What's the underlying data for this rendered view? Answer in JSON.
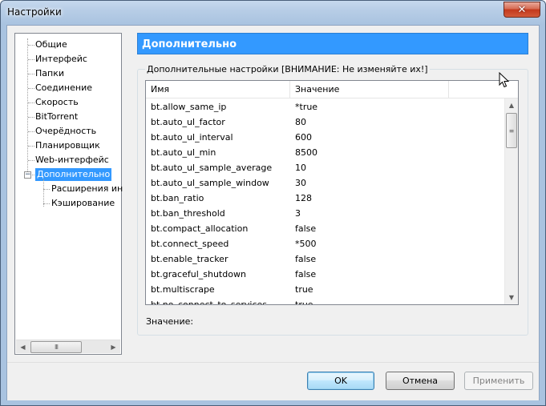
{
  "window": {
    "title": "Настройки",
    "close_glyph": "✕"
  },
  "tree": {
    "items": [
      {
        "label": "Общие"
      },
      {
        "label": "Интерфейс"
      },
      {
        "label": "Папки"
      },
      {
        "label": "Соединение"
      },
      {
        "label": "Скорость"
      },
      {
        "label": "BitTorrent"
      },
      {
        "label": "Очерёдность"
      },
      {
        "label": "Планировщик"
      },
      {
        "label": "Web-интерфейс"
      },
      {
        "label": "Дополнительно",
        "selected": true,
        "expander": "−"
      },
      {
        "label": "Расширения ин"
      },
      {
        "label": "Кэширование"
      }
    ],
    "scroll_left_glyph": "◀",
    "scroll_right_glyph": "▶",
    "scroll_grip": "III"
  },
  "section": {
    "title": "Дополнительно"
  },
  "group": {
    "label": "Дополнительные настройки [ВНИМАНИЕ: Не изменяйте их!]"
  },
  "table": {
    "columns": [
      "Имя",
      "Значение"
    ],
    "rows": [
      {
        "name": "bt.allow_same_ip",
        "value": "*true"
      },
      {
        "name": "bt.auto_ul_factor",
        "value": "80"
      },
      {
        "name": "bt.auto_ul_interval",
        "value": "600"
      },
      {
        "name": "bt.auto_ul_min",
        "value": "8500"
      },
      {
        "name": "bt.auto_ul_sample_average",
        "value": "10"
      },
      {
        "name": "bt.auto_ul_sample_window",
        "value": "30"
      },
      {
        "name": "bt.ban_ratio",
        "value": "128"
      },
      {
        "name": "bt.ban_threshold",
        "value": "3"
      },
      {
        "name": "bt.compact_allocation",
        "value": "false"
      },
      {
        "name": "bt.connect_speed",
        "value": "*500"
      },
      {
        "name": "bt.enable_tracker",
        "value": "false"
      },
      {
        "name": "bt.graceful_shutdown",
        "value": "false"
      },
      {
        "name": "bt.multiscrape",
        "value": "true"
      },
      {
        "name": "bt.no_connect_to_services",
        "value": "true"
      }
    ],
    "scroll_up_glyph": "▲",
    "scroll_down_glyph": "▼"
  },
  "value_field": {
    "label": "Значение:"
  },
  "buttons": {
    "ok": "OK",
    "cancel": "Отмена",
    "apply": "Применить"
  }
}
